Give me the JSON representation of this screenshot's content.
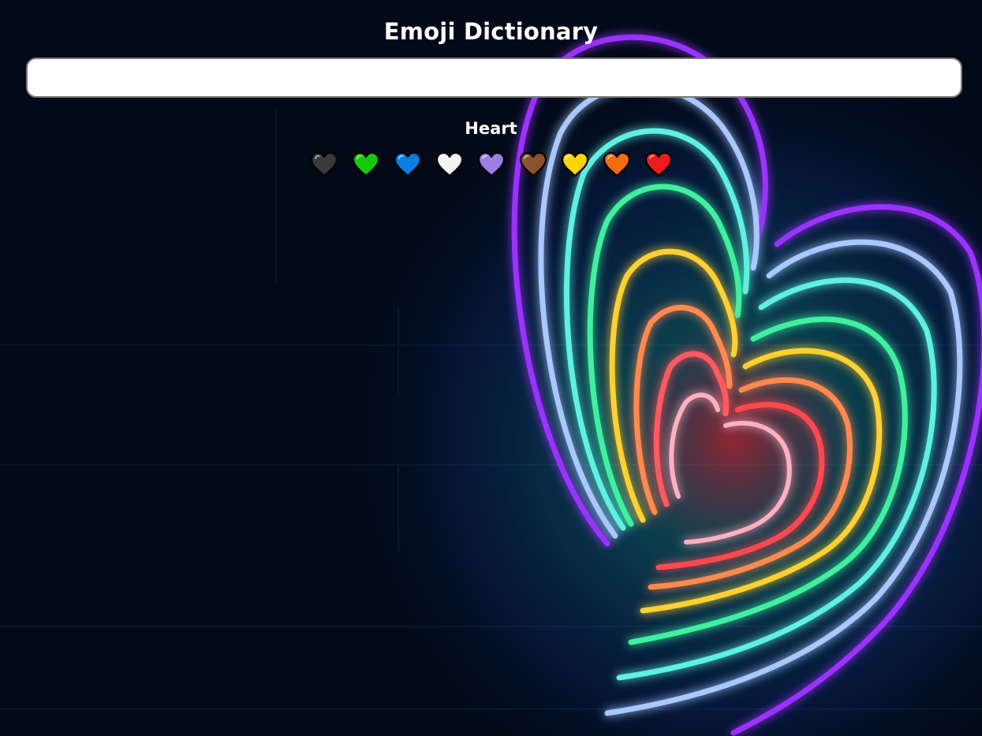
{
  "app": {
    "title": "Emoji Dictionary"
  },
  "search": {
    "value": "",
    "placeholder": ""
  },
  "category": {
    "label": "Heart"
  },
  "emojis": [
    {
      "name": "black-heart-icon",
      "color": "#3a3a3a"
    },
    {
      "name": "green-heart-icon",
      "color": "#17c80e"
    },
    {
      "name": "blue-heart-icon",
      "color": "#0a7ee0"
    },
    {
      "name": "white-heart-icon",
      "color": "#f4f4f4"
    },
    {
      "name": "purple-heart-icon",
      "color": "#9d7ee6"
    },
    {
      "name": "brown-heart-icon",
      "color": "#8a5330"
    },
    {
      "name": "yellow-heart-icon",
      "color": "#ffd400"
    },
    {
      "name": "orange-heart-icon",
      "color": "#f26b0f"
    },
    {
      "name": "red-heart-icon",
      "color": "#ec1c1c"
    }
  ],
  "background": {
    "base_color": "#020a18",
    "neon_colors": [
      "#9b30ff",
      "#a8c8ff",
      "#5ff0e0",
      "#40f0a0",
      "#ffd030",
      "#ff8a50",
      "#ff4a50",
      "#ffb0c0"
    ]
  }
}
